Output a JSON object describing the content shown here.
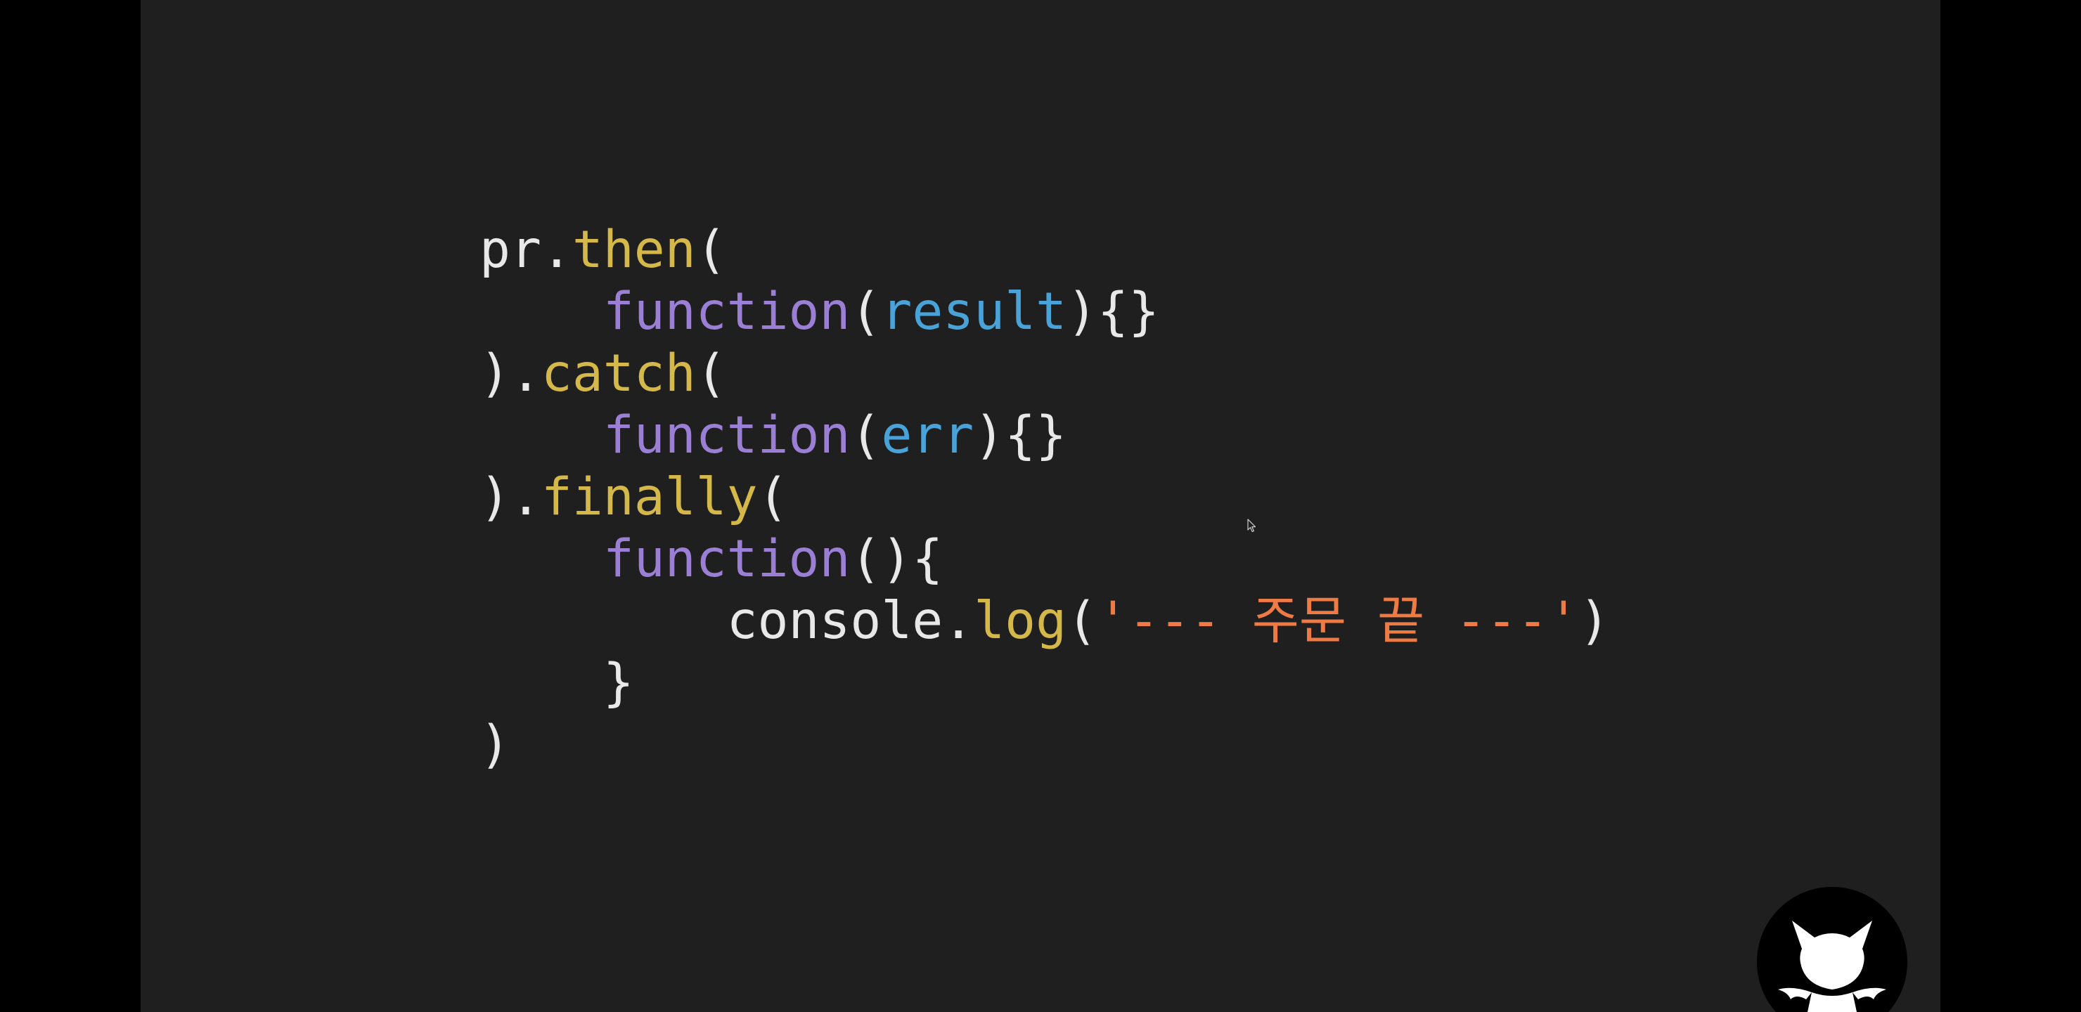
{
  "code_block": {
    "lines": [
      [
        {
          "text": "pr.",
          "role": "plain"
        },
        {
          "text": "then",
          "role": "method"
        },
        {
          "text": "(",
          "role": "plain"
        }
      ],
      [
        {
          "text": "    ",
          "role": "plain"
        },
        {
          "text": "function",
          "role": "keyword"
        },
        {
          "text": "(",
          "role": "plain"
        },
        {
          "text": "result",
          "role": "param"
        },
        {
          "text": "){}",
          "role": "plain"
        }
      ],
      [
        {
          "text": ").",
          "role": "plain"
        },
        {
          "text": "catch",
          "role": "method"
        },
        {
          "text": "(",
          "role": "plain"
        }
      ],
      [
        {
          "text": "    ",
          "role": "plain"
        },
        {
          "text": "function",
          "role": "keyword"
        },
        {
          "text": "(",
          "role": "plain"
        },
        {
          "text": "err",
          "role": "param"
        },
        {
          "text": "){}",
          "role": "plain"
        }
      ],
      [
        {
          "text": ").",
          "role": "plain"
        },
        {
          "text": "finally",
          "role": "method"
        },
        {
          "text": "(",
          "role": "plain"
        }
      ],
      [
        {
          "text": "    ",
          "role": "plain"
        },
        {
          "text": "function",
          "role": "keyword"
        },
        {
          "text": "(){",
          "role": "plain"
        }
      ],
      [
        {
          "text": "        console.",
          "role": "plain"
        },
        {
          "text": "log",
          "role": "method"
        },
        {
          "text": "(",
          "role": "plain"
        },
        {
          "text": "'--- 주문 끝 ---'",
          "role": "string"
        },
        {
          "text": ")",
          "role": "plain"
        }
      ],
      [
        {
          "text": "    }",
          "role": "plain"
        }
      ],
      [
        {
          "text": ")",
          "role": "plain"
        }
      ]
    ]
  },
  "syntax_colors": {
    "background": "#1f1f1f",
    "plain": "#e8e8e8",
    "method": "#d4b84a",
    "keyword": "#9b7fd4",
    "param": "#4aa3d8",
    "string": "#ee7a45"
  },
  "icons": {
    "cursor": "mouse-pointer-icon",
    "mascot": "cat-devil-mascot-icon"
  }
}
